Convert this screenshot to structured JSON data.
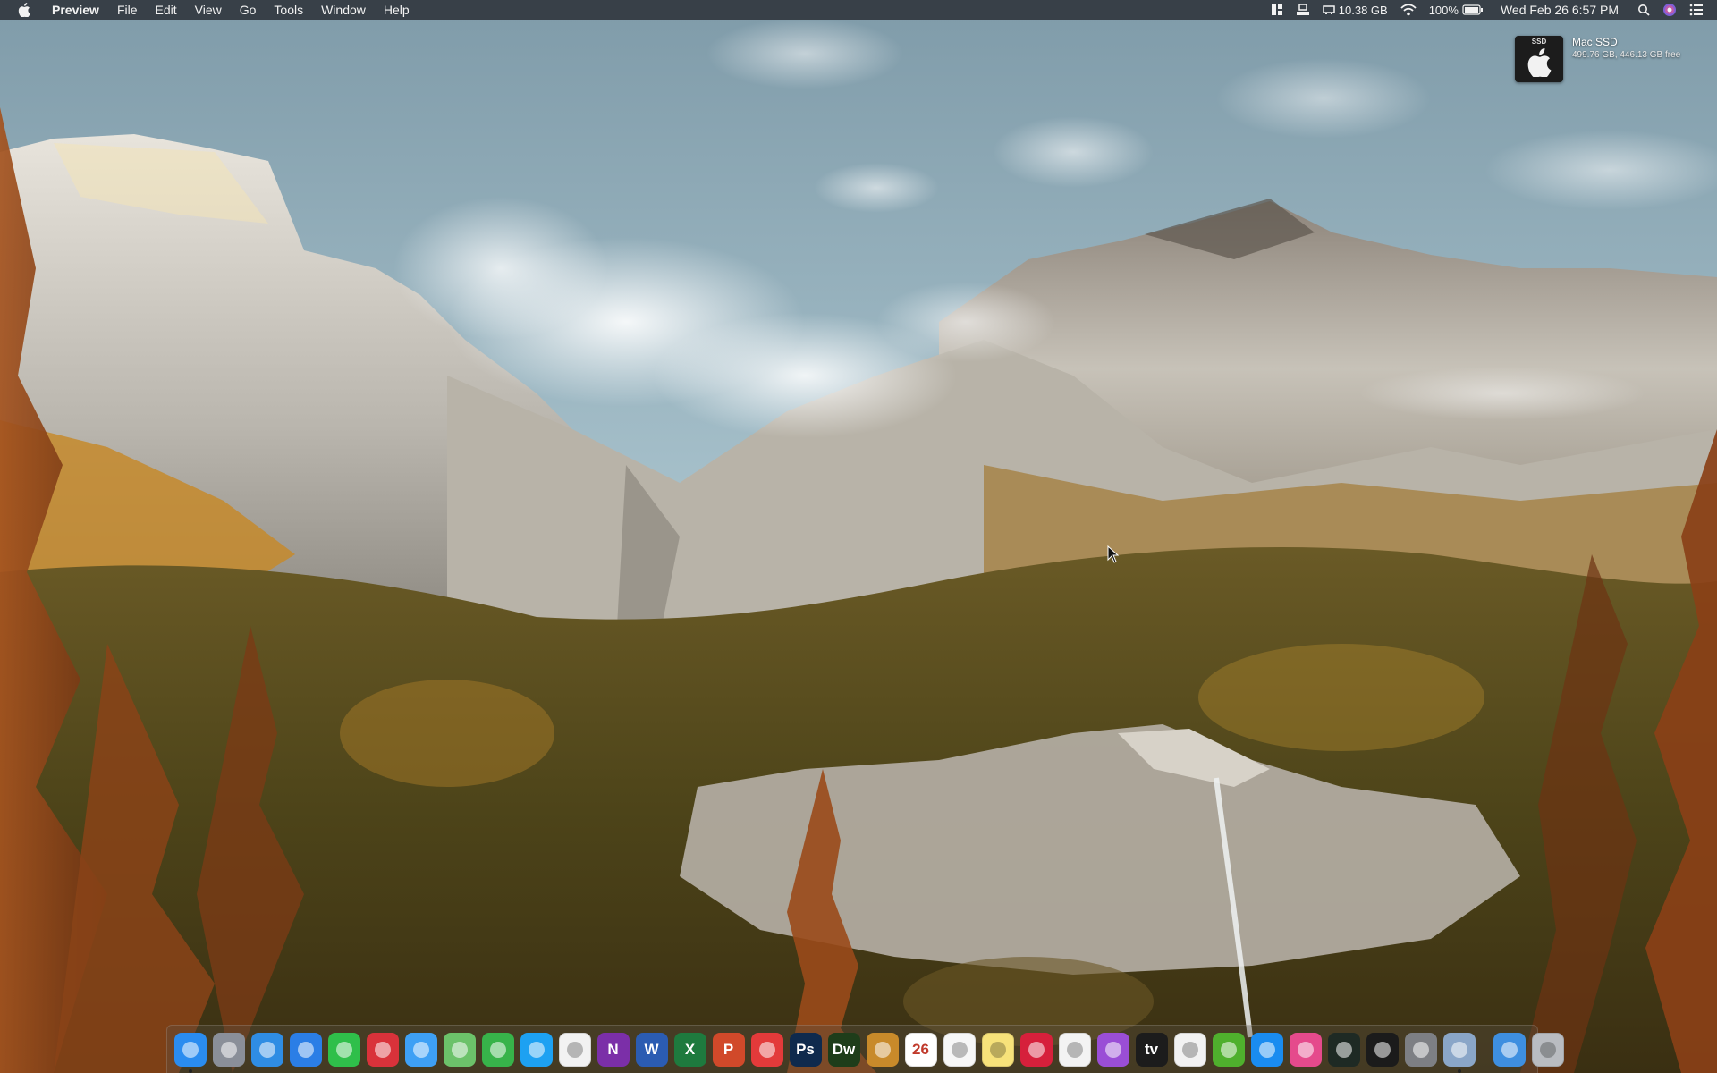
{
  "menubar": {
    "app_name": "Preview",
    "menus": [
      "File",
      "Edit",
      "View",
      "Go",
      "Tools",
      "Window",
      "Help"
    ],
    "status": {
      "memory": "10.38 GB",
      "battery": "100%",
      "datetime": "Wed Feb 26  6:57 PM"
    },
    "icons": [
      "grid-icon",
      "display-icon",
      "memory-icon",
      "wifi-icon",
      "battery-icon",
      "spotlight-icon",
      "siri-icon",
      "notification-center-icon"
    ]
  },
  "desktop": {
    "disk": {
      "badge": "SSD",
      "name": "Mac SSD",
      "space": "499.76 GB, 446.13 GB free"
    }
  },
  "dock": {
    "apps": [
      {
        "name": "finder",
        "glyph": "",
        "color": "#2a8cf0",
        "running": true
      },
      {
        "name": "launchpad",
        "glyph": "",
        "color": "#8a8f99"
      },
      {
        "name": "safari",
        "glyph": "",
        "color": "#2f8de4"
      },
      {
        "name": "mail",
        "glyph": "",
        "color": "#2b7ee6"
      },
      {
        "name": "facetime",
        "glyph": "",
        "color": "#2fbf4a"
      },
      {
        "name": "photo-booth",
        "glyph": "",
        "color": "#d9323a"
      },
      {
        "name": "messages",
        "glyph": "",
        "color": "#3ea0f5"
      },
      {
        "name": "maps",
        "glyph": "",
        "color": "#6cc26a"
      },
      {
        "name": "find-my",
        "glyph": "",
        "color": "#37b34a"
      },
      {
        "name": "twitter",
        "glyph": "",
        "color": "#1da1f2"
      },
      {
        "name": "photos",
        "glyph": "",
        "color": "#f2f2f2"
      },
      {
        "name": "onenote",
        "glyph": "N",
        "color": "#7b2fa8"
      },
      {
        "name": "word",
        "glyph": "W",
        "color": "#2b5cb2"
      },
      {
        "name": "excel",
        "glyph": "X",
        "color": "#1e7a3e"
      },
      {
        "name": "powerpoint",
        "glyph": "P",
        "color": "#d1492a"
      },
      {
        "name": "pdf-expert",
        "glyph": "",
        "color": "#e33a3a"
      },
      {
        "name": "photoshop",
        "glyph": "Ps",
        "color": "#0f2a4d"
      },
      {
        "name": "dreamweaver",
        "glyph": "Dw",
        "color": "#1e3d1a"
      },
      {
        "name": "garageband",
        "glyph": "",
        "color": "#c88a2a"
      },
      {
        "name": "calendar",
        "glyph": "26",
        "color": "#ffffff"
      },
      {
        "name": "reminders",
        "glyph": "",
        "color": "#f7f7f7"
      },
      {
        "name": "notes",
        "glyph": "",
        "color": "#f7e27a"
      },
      {
        "name": "iheartradio",
        "glyph": "",
        "color": "#d6203b"
      },
      {
        "name": "music",
        "glyph": "",
        "color": "#f3f3f3"
      },
      {
        "name": "podcasts",
        "glyph": "",
        "color": "#9a4ed6"
      },
      {
        "name": "apple-tv",
        "glyph": "tv",
        "color": "#1c1c1c"
      },
      {
        "name": "news",
        "glyph": "",
        "color": "#f2f2f2"
      },
      {
        "name": "utorrent",
        "glyph": "",
        "color": "#4fb02d"
      },
      {
        "name": "app-store",
        "glyph": "",
        "color": "#1a8cf0"
      },
      {
        "name": "cleanmymac",
        "glyph": "",
        "color": "#e54a8c"
      },
      {
        "name": "activity-monitor",
        "glyph": "",
        "color": "#1e2a24"
      },
      {
        "name": "terminal",
        "glyph": "",
        "color": "#1b1b1b"
      },
      {
        "name": "system-preferences",
        "glyph": "",
        "color": "#7d7f84"
      },
      {
        "name": "preview",
        "glyph": "",
        "color": "#8aa6c8",
        "running": true
      }
    ],
    "right": [
      {
        "name": "downloads-stack",
        "glyph": "",
        "color": "#3e8fe0"
      },
      {
        "name": "trash",
        "glyph": "",
        "color": "#b9bcc1"
      }
    ]
  },
  "colors": {
    "menubar_bg": "#2c3036",
    "sky": "#8fb0bf",
    "mountain": "#c9c6c0",
    "forest": "#6b5a2a",
    "autumn": "#b5612a"
  }
}
